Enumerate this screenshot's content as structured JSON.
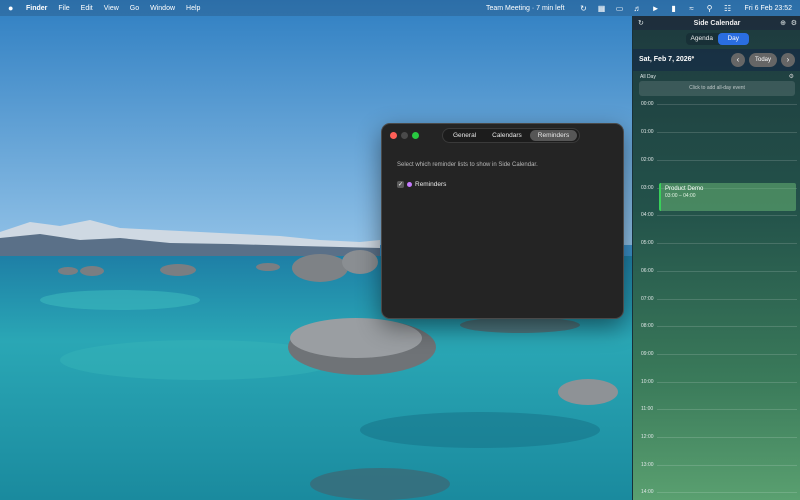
{
  "menubar": {
    "apple": "",
    "items": [
      "Finder",
      "File",
      "Edit",
      "View",
      "Go",
      "Window",
      "Help"
    ],
    "event_status": "Team Meeting · 7 min left",
    "tray_icons": [
      "sync-icon",
      "dark-calendar-icon",
      "display-icon",
      "volume-icon",
      "play-icon",
      "battery-icon",
      "wifi-icon",
      "search-icon",
      "control-center-icon"
    ],
    "clock": "Fri 6 Feb  23:52"
  },
  "settings_window": {
    "tabs": [
      "General",
      "Calendars",
      "Reminders"
    ],
    "active_tab": "Reminders",
    "hint": "Select which reminder lists to show in Side Calendar.",
    "lists": [
      {
        "name": "Reminders",
        "checked": true,
        "color": "#c67bff"
      }
    ]
  },
  "side_calendar": {
    "title": "Side Calendar",
    "view_options": [
      "Agenda",
      "Day"
    ],
    "active_view": "Day",
    "date": "Sat, Feb 7, 2026",
    "today_label": "Today",
    "allday_label": "All Day",
    "allday_placeholder": "Click to add all-day event",
    "hours": [
      "00:00",
      "01:00",
      "02:00",
      "03:00",
      "04:00",
      "05:00",
      "06:00",
      "07:00",
      "08:00",
      "09:00",
      "10:00",
      "11:00",
      "12:00",
      "13:00",
      "14:00"
    ],
    "events": [
      {
        "title": "Product Demo",
        "time": "03:00 – 04:00",
        "color": "#39d05a"
      }
    ]
  },
  "colors": {
    "accent": "#2a6ee0",
    "event": "#39d05a",
    "reminder": "#c67bff"
  }
}
